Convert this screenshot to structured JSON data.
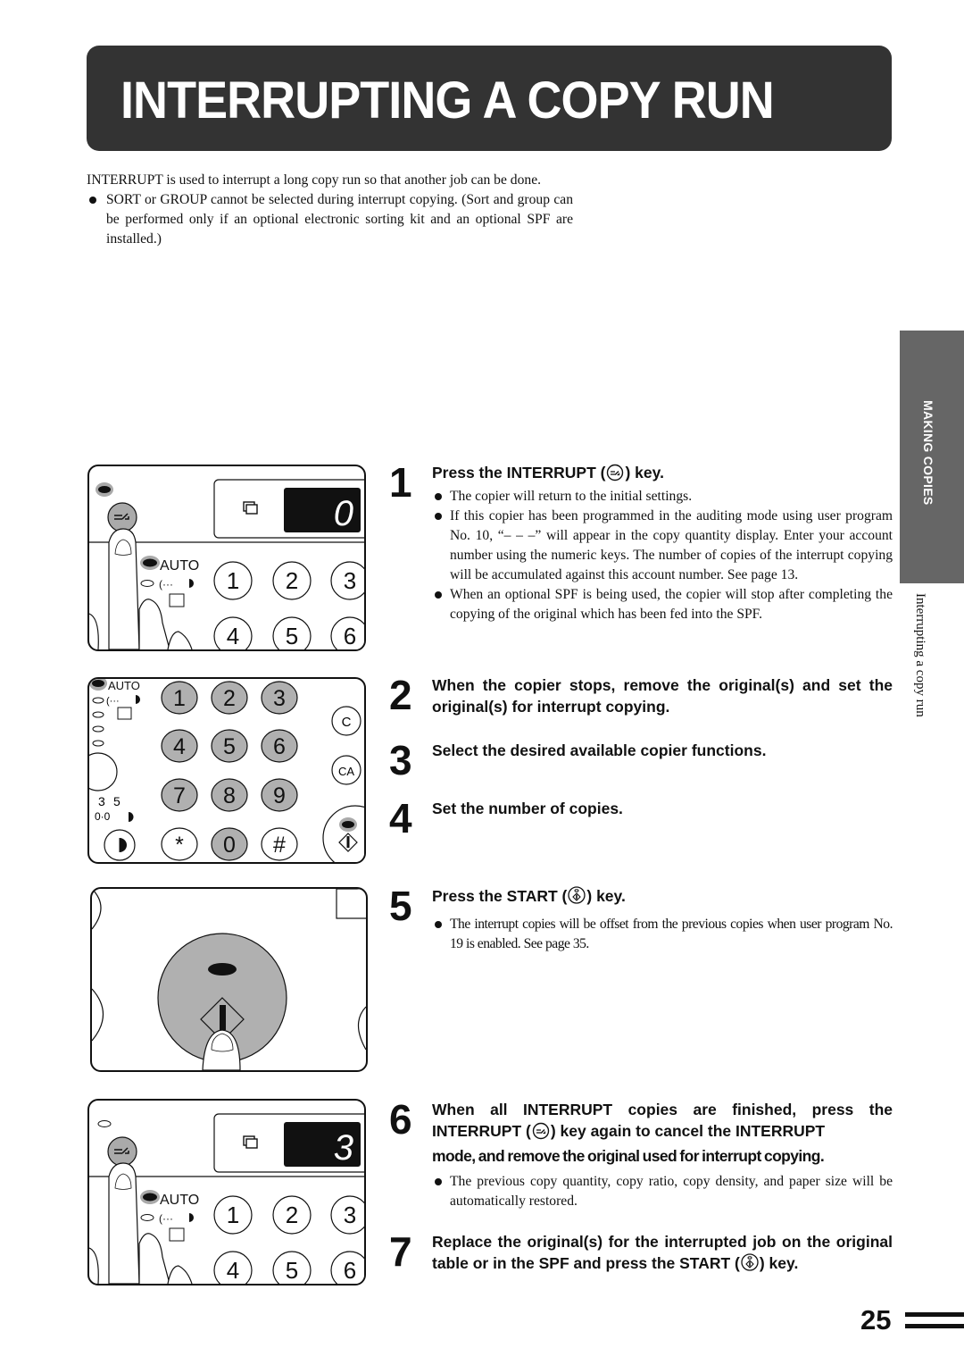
{
  "page": {
    "title": "INTERRUPTING A COPY RUN",
    "page_number": "25",
    "side_tab": "MAKING COPIES",
    "side_subtitle": "Interrupting a copy run"
  },
  "intro": {
    "paragraph": "INTERRUPT is used to interrupt a long copy run so that another job can be done.",
    "bullets": [
      "SORT or GROUP cannot be selected during interrupt copying. (Sort and group can be performed only if an optional electronic sorting kit and an optional SPF are installed.)"
    ]
  },
  "icons": {
    "interrupt": "interrupt-key-icon",
    "start": "start-key-icon"
  },
  "steps": [
    {
      "number": "1",
      "heading_pre": "Press the INTERRUPT (",
      "heading_post": ") key.",
      "notes": [
        "The copier will return to the initial settings.",
        "If this copier has been programmed in the auditing mode using user program No. 10, “– – –” will appear in the copy quantity display. Enter your account number using the numeric keys. The number of copies of the interrupt copying will be accumulated against this account number. See page 13.",
        "When an optional SPF is being used, the copier will stop after completing the copying of the original which has been fed into the SPF."
      ]
    },
    {
      "number": "2",
      "heading": "When the copier stops, remove the original(s) and set the original(s) for interrupt copying."
    },
    {
      "number": "3",
      "heading": "Select the desired available copier functions."
    },
    {
      "number": "4",
      "heading": "Set the number of copies."
    },
    {
      "number": "5",
      "heading_pre": "Press the START (",
      "heading_post": ") key.",
      "notes": [
        "The interrupt copies will be offset from the previous copies when user program No. 19 is enabled. See page 35."
      ]
    },
    {
      "number": "6",
      "heading_line1": "When all INTERRUPT copies are finished, press the",
      "heading_pre": "INTERRUPT (",
      "heading_post": ") key again to cancel the INTERRUPT",
      "heading_line3": "mode, and remove the original used for interrupt copying.",
      "notes": [
        "The previous copy quantity, copy ratio, copy density, and paper size will be automatically restored."
      ]
    },
    {
      "number": "7",
      "heading_pre": "Replace the original(s) for the interrupted job on the original table or in the SPF and press the START (",
      "heading_post": ") key."
    }
  ],
  "illustrations": {
    "panel1": {
      "display": "0",
      "auto_label": "AUTO",
      "keys": [
        "1",
        "2",
        "3",
        "4",
        "5",
        "6"
      ]
    },
    "panel2": {
      "auto_label": "AUTO",
      "keys": [
        "1",
        "2",
        "3",
        "4",
        "5",
        "6",
        "7",
        "8",
        "9",
        "*",
        "0",
        "#"
      ],
      "clear": "C",
      "clear_all": "CA",
      "density_labels": [
        "3",
        "5"
      ]
    },
    "panel4": {
      "display": "3",
      "auto_label": "AUTO",
      "keys": [
        "1",
        "2",
        "3",
        "4",
        "5",
        "6"
      ]
    }
  }
}
